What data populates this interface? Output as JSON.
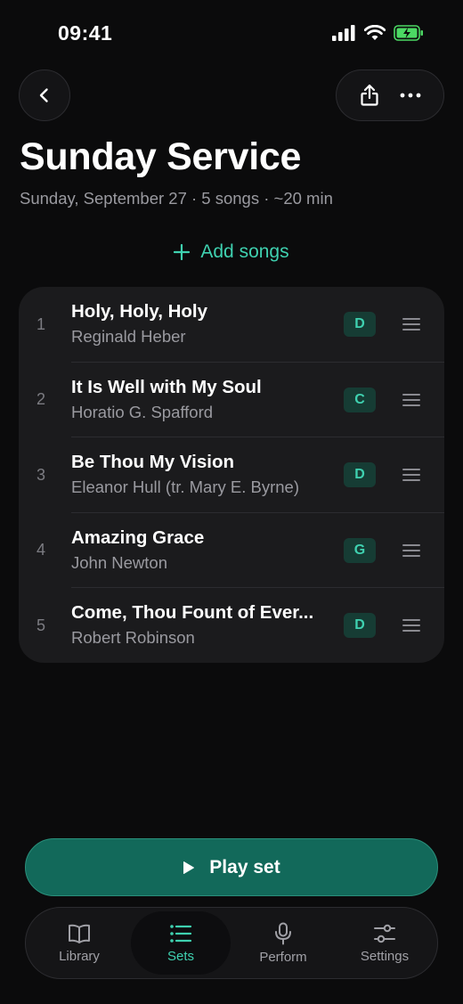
{
  "status_bar": {
    "time": "09:41"
  },
  "header": {
    "back_icon": "chevron-left-icon",
    "share_icon": "share-icon",
    "more_icon": "more-horizontal-icon"
  },
  "set": {
    "title": "Sunday Service",
    "subtitle": "Sunday, September 27 · 5 songs · ~20 min"
  },
  "add_songs": {
    "label": "Add songs",
    "icon": "plus-icon"
  },
  "songs": [
    {
      "number": "1",
      "title": "Holy, Holy, Holy",
      "author": "Reginald Heber",
      "key": "D"
    },
    {
      "number": "2",
      "title": "It Is Well with My Soul",
      "author": "Horatio G. Spafford",
      "key": "C"
    },
    {
      "number": "3",
      "title": "Be Thou My Vision",
      "author": "Eleanor Hull (tr. Mary E. Byrne)",
      "key": "D"
    },
    {
      "number": "4",
      "title": "Amazing Grace",
      "author": "John Newton",
      "key": "G"
    },
    {
      "number": "5",
      "title": "Come, Thou Fount of Ever...",
      "author": "Robert Robinson",
      "key": "D"
    }
  ],
  "play_button": {
    "label": "Play set",
    "icon": "play-icon"
  },
  "tabs": [
    {
      "label": "Library",
      "icon": "book-icon",
      "active": false
    },
    {
      "label": "Sets",
      "icon": "list-icon",
      "active": true
    },
    {
      "label": "Perform",
      "icon": "microphone-icon",
      "active": false
    },
    {
      "label": "Settings",
      "icon": "sliders-icon",
      "active": false
    }
  ],
  "colors": {
    "accent": "#3fd1b0",
    "background": "#0b0b0c",
    "card": "#1b1b1d",
    "play_button": "#12695a",
    "key_badge_bg": "#163c34",
    "battery": "#4cd964"
  }
}
